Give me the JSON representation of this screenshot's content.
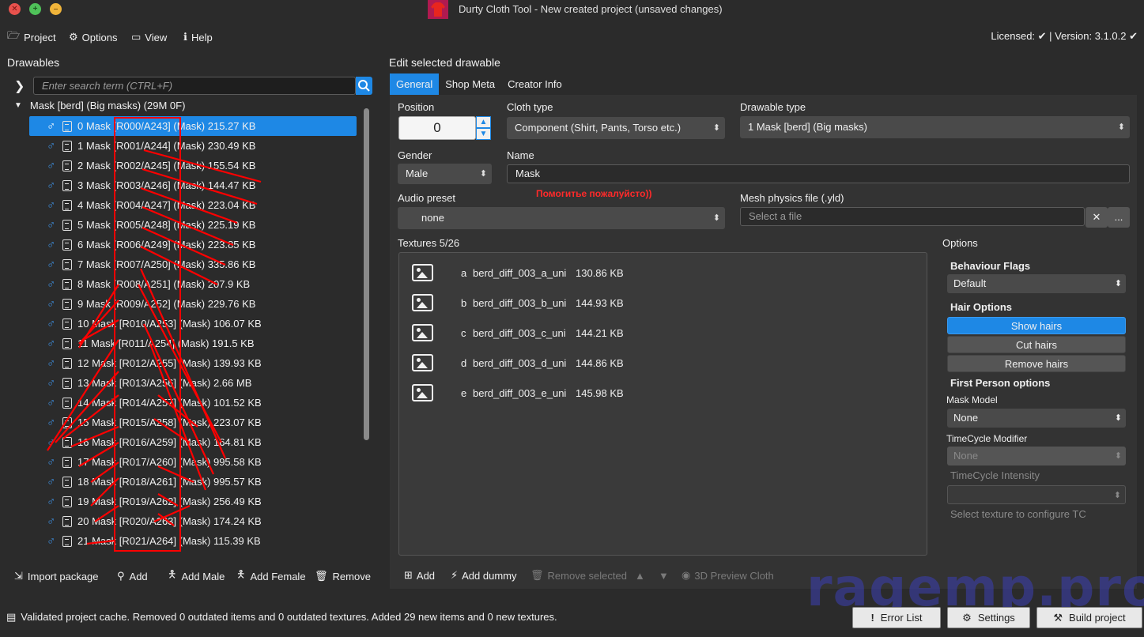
{
  "window": {
    "title": "Durty Cloth Tool - New created project (unsaved changes)"
  },
  "menu": {
    "project": "Project",
    "options": "Options",
    "view": "View",
    "help": "Help"
  },
  "license": {
    "text": "Licensed: ✔ | Version: 3.1.0.2 ✔"
  },
  "left": {
    "title": "Drawables",
    "search_placeholder": "Enter search term (CTRL+F)",
    "root_label": "Mask [berd] (Big masks) (29M 0F)",
    "items": [
      {
        "label": "0  Mask [R000/A243]  (Mask)  215.27 KB",
        "selected": true
      },
      {
        "label": "1  Mask [R001/A244]  (Mask)  230.49 KB"
      },
      {
        "label": "2  Mask [R002/A245]  (Mask)  155.54 KB"
      },
      {
        "label": "3  Mask [R003/A246]  (Mask)  144.47 KB"
      },
      {
        "label": "4  Mask [R004/A247]  (Mask)  223.04 KB"
      },
      {
        "label": "5  Mask [R005/A248]  (Mask)  225.19 KB"
      },
      {
        "label": "6  Mask [R006/A249]  (Mask)  223.85 KB"
      },
      {
        "label": "7  Mask [R007/A250]  (Mask)  335.86 KB"
      },
      {
        "label": "8  Mask [R008/A251]  (Mask)  207.9 KB"
      },
      {
        "label": "9  Mask [R009/A252]  (Mask)  229.76 KB"
      },
      {
        "label": "10  Mask [R010/A253]  (Mask)  106.07 KB"
      },
      {
        "label": "11  Mask [R011/A254]  (Mask)  191.5 KB"
      },
      {
        "label": "12  Mask [R012/A255]  (Mask)  139.93 KB"
      },
      {
        "label": "13  Mask [R013/A256]  (Mask)  2.66 MB"
      },
      {
        "label": "14  Mask [R014/A257]  (Mask)  101.52 KB"
      },
      {
        "label": "15  Mask [R015/A258]  (Mask)  223.07 KB"
      },
      {
        "label": "16  Mask [R016/A259]  (Mask)  164.81 KB"
      },
      {
        "label": "17  Mask [R017/A260]  (Mask)  995.58 KB"
      },
      {
        "label": "18  Mask [R018/A261]  (Mask)  995.57 KB"
      },
      {
        "label": "19  Mask [R019/A262]  (Mask)  256.49 KB"
      },
      {
        "label": "20  Mask [R020/A263]  (Mask)  174.24 KB"
      },
      {
        "label": "21  Mask [R021/A264]  (Mask)  115.39 KB"
      }
    ],
    "actions": {
      "import": "Import package",
      "add": "Add",
      "add_male": "Add Male",
      "add_female": "Add Female",
      "remove": "Remove"
    }
  },
  "right": {
    "title": "Edit selected drawable",
    "tabs": [
      "General",
      "Shop Meta",
      "Creator Info"
    ],
    "position_label": "Position",
    "position_value": "0",
    "cloth_type_label": "Cloth type",
    "cloth_type_value": "Component (Shirt, Pants, Torso etc.)",
    "drawable_type_label": "Drawable type",
    "drawable_type_value": "1     Mask [berd] (Big masks)",
    "gender_label": "Gender",
    "gender_value": "Male",
    "name_label": "Name",
    "name_value": "Mask",
    "audio_label": "Audio preset",
    "audio_value": "none",
    "help_text": "Помогитье пожалуйсто))",
    "mesh_label": "Mesh physics file (.yld)",
    "mesh_placeholder": "Select a file",
    "mesh_clear": "✕",
    "mesh_browse": "...",
    "textures_label": "Textures 5/26",
    "textures": [
      {
        "letter": "a",
        "name": "berd_diff_003_a_uni",
        "size": "130.86 KB"
      },
      {
        "letter": "b",
        "name": "berd_diff_003_b_uni",
        "size": "144.93 KB"
      },
      {
        "letter": "c",
        "name": "berd_diff_003_c_uni",
        "size": "144.21 KB"
      },
      {
        "letter": "d",
        "name": "berd_diff_003_d_uni",
        "size": "144.86 KB"
      },
      {
        "letter": "e",
        "name": "berd_diff_003_e_uni",
        "size": "145.98 KB"
      }
    ],
    "texture_actions": {
      "add": "Add",
      "add_dummy": "Add dummy",
      "remove_selected": "Remove selected",
      "preview": "3D Preview Cloth"
    }
  },
  "options": {
    "title": "Options",
    "behaviour_flags_label": "Behaviour Flags",
    "behaviour_flags_value": "Default",
    "hair_options_label": "Hair Options",
    "show_hairs": "Show hairs",
    "cut_hairs": "Cut hairs",
    "remove_hairs": "Remove hairs",
    "first_person_label": "First Person options",
    "mask_model_label": "Mask Model",
    "mask_model_value": "None",
    "timecycle_modifier_label": "TimeCycle Modifier",
    "timecycle_modifier_value": "None",
    "timecycle_intensity_label": "TimeCycle Intensity",
    "tc_hint": "Select texture to configure TC"
  },
  "status": {
    "message": "Validated project cache. Removed 0 outdated items and 0 outdated textures. Added 29 new items and 0 new textures.",
    "error_list": "Error List",
    "settings": "Settings",
    "build": "Build project"
  },
  "watermark": "ragemp.pro",
  "colors": {
    "accent": "#1e88e5",
    "background": "#2b2b2b",
    "annotation": "#ff0000"
  }
}
